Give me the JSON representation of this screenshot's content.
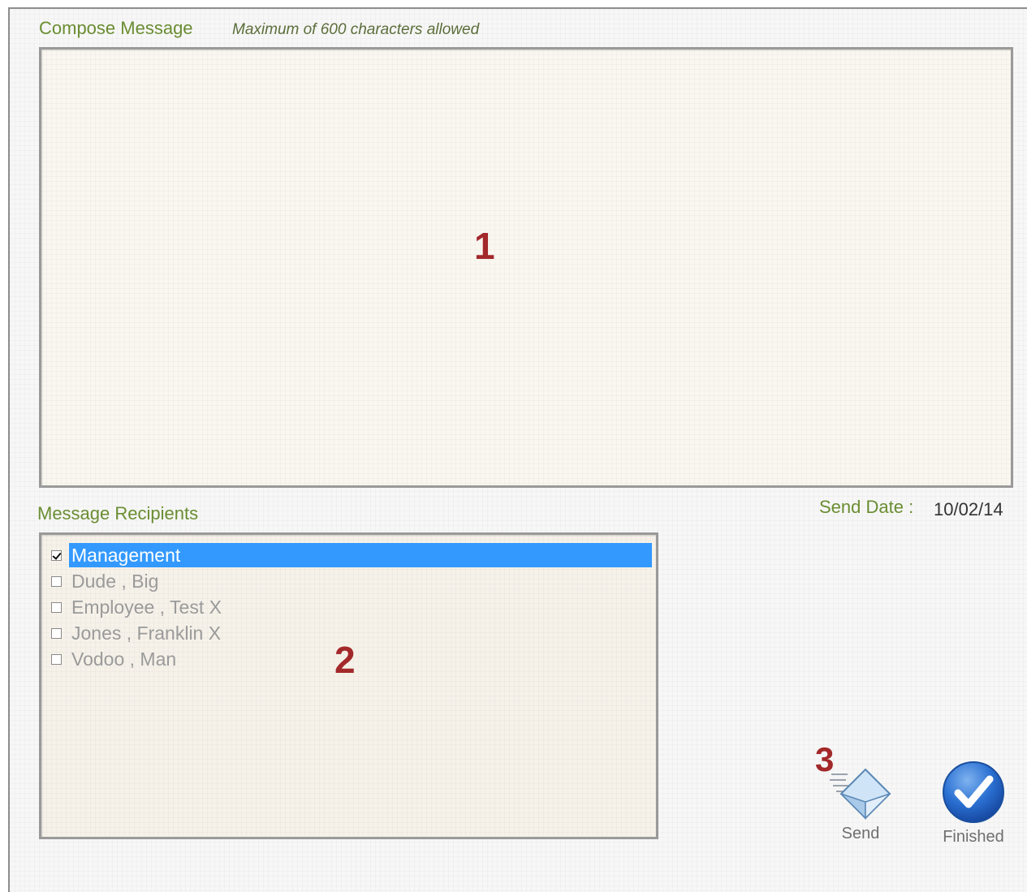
{
  "compose": {
    "title": "Compose Message",
    "hint": "Maximum of 600 characters allowed",
    "message_value": ""
  },
  "recipients": {
    "title": "Message Recipients",
    "items": [
      {
        "label": "Management",
        "checked": true,
        "selected": true
      },
      {
        "label": "Dude , Big",
        "checked": false,
        "selected": false
      },
      {
        "label": "Employee , Test X",
        "checked": false,
        "selected": false
      },
      {
        "label": "Jones , Franklin X",
        "checked": false,
        "selected": false
      },
      {
        "label": "Vodoo , Man",
        "checked": false,
        "selected": false
      }
    ]
  },
  "send_date": {
    "label": "Send Date :",
    "value": "10/02/14"
  },
  "actions": {
    "send_label": "Send",
    "send_icon": "envelope-send-icon",
    "finished_label": "Finished",
    "finished_icon": "checkmark-circle-icon"
  },
  "callouts": {
    "one": "1",
    "two": "2",
    "three": "3"
  },
  "colors": {
    "section_title": "#6a8d32",
    "callout": "#a3282a",
    "selection": "#3399ff",
    "finished_icon": "#2a6fd1"
  }
}
